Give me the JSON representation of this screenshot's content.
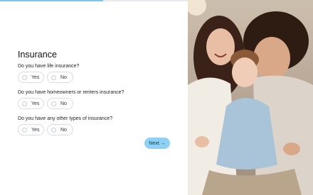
{
  "progress": {
    "value_percent": 55
  },
  "form": {
    "title": "Insurance",
    "questions": [
      {
        "text": "Do you have life insurance?",
        "options": [
          "Yes",
          "No"
        ]
      },
      {
        "text": "Do you have homeowners or renters insurance?",
        "options": [
          "Yes",
          "No"
        ]
      },
      {
        "text": "Do you have any other types of insurance?",
        "options": [
          "Yes",
          "No"
        ]
      }
    ],
    "next_label": "Next",
    "next_icon": "→"
  },
  "colors": {
    "accent": "#8fd0f5",
    "progress": "#7cc7f0"
  },
  "photo": {
    "icon": "family-photo"
  }
}
